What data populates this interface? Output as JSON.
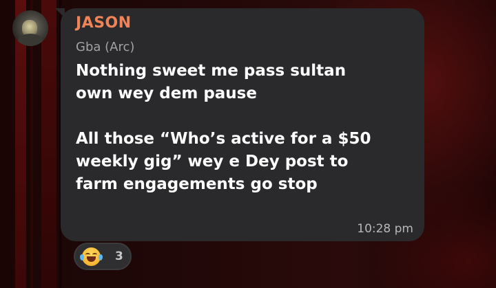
{
  "message": {
    "sender": "JASON",
    "subtitle": "Gba (Arc)",
    "text": "Nothing sweet me pass sultan\nown wey dem pause\n\nAll those “Who’s active for a $50\nweekly gig” wey e Dey post to\nfarm engagements go stop",
    "timestamp": "10:28 pm"
  },
  "reaction": {
    "emoji": "face-with-tears-of-joy-icon",
    "count": "3"
  },
  "colors": {
    "sender_name": "#f08458",
    "bubble": "#2a2a2c",
    "background": "#220808"
  }
}
